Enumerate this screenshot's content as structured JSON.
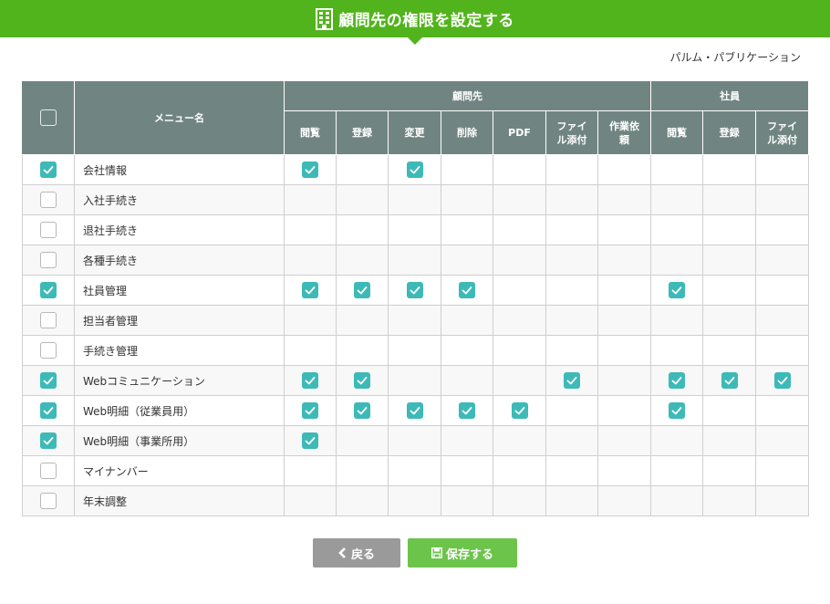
{
  "header": {
    "title": "顧問先の権限を設定する",
    "icon": "building-icon"
  },
  "company_name": "パルム・パブリケーション",
  "table": {
    "menu_col_label": "メニュー名",
    "group_client": "顧問先",
    "group_employee": "社員",
    "client_cols": [
      "閲覧",
      "登録",
      "変更",
      "削除",
      "PDF",
      "ファイル添付",
      "作業依頼"
    ],
    "client_cols_display": [
      "閲覧",
      "登録",
      "変更",
      "削除",
      "PDF",
      "ファイ\nル添付",
      "作業依\n頼"
    ],
    "employee_cols_display": [
      "閲覧",
      "登録",
      "ファイ\nル添付"
    ],
    "rows": [
      {
        "name": "会社情報",
        "checked": true,
        "client": [
          1,
          0,
          1,
          0,
          0,
          0,
          0
        ],
        "employee": [
          0,
          0,
          0
        ]
      },
      {
        "name": "入社手続き",
        "checked": false,
        "client": [
          0,
          0,
          0,
          0,
          0,
          0,
          0
        ],
        "employee": [
          0,
          0,
          0
        ]
      },
      {
        "name": "退社手続き",
        "checked": false,
        "client": [
          0,
          0,
          0,
          0,
          0,
          0,
          0
        ],
        "employee": [
          0,
          0,
          0
        ]
      },
      {
        "name": "各種手続き",
        "checked": false,
        "client": [
          0,
          0,
          0,
          0,
          0,
          0,
          0
        ],
        "employee": [
          0,
          0,
          0
        ]
      },
      {
        "name": "社員管理",
        "checked": true,
        "client": [
          1,
          1,
          1,
          1,
          0,
          0,
          0
        ],
        "employee": [
          1,
          0,
          0
        ]
      },
      {
        "name": "担当者管理",
        "checked": false,
        "client": [
          0,
          0,
          0,
          0,
          0,
          0,
          0
        ],
        "employee": [
          0,
          0,
          0
        ]
      },
      {
        "name": "手続き管理",
        "checked": false,
        "client": [
          0,
          0,
          0,
          0,
          0,
          0,
          0
        ],
        "employee": [
          0,
          0,
          0
        ]
      },
      {
        "name": "Webコミュニケーション",
        "checked": true,
        "client": [
          1,
          1,
          0,
          0,
          0,
          1,
          0
        ],
        "employee": [
          1,
          1,
          1
        ]
      },
      {
        "name": "Web明細（従業員用）",
        "checked": true,
        "client": [
          1,
          1,
          1,
          1,
          1,
          0,
          0
        ],
        "employee": [
          1,
          0,
          0
        ]
      },
      {
        "name": "Web明細（事業所用）",
        "checked": true,
        "client": [
          1,
          0,
          0,
          0,
          0,
          0,
          0
        ],
        "employee": [
          0,
          0,
          0
        ]
      },
      {
        "name": "マイナンバー",
        "checked": false,
        "client": [
          0,
          0,
          0,
          0,
          0,
          0,
          0
        ],
        "employee": [
          0,
          0,
          0
        ]
      },
      {
        "name": "年末調整",
        "checked": false,
        "client": [
          0,
          0,
          0,
          0,
          0,
          0,
          0
        ],
        "employee": [
          0,
          0,
          0
        ]
      }
    ]
  },
  "buttons": {
    "back_label": "戻る",
    "save_label": "保存する"
  },
  "colors": {
    "brand_green": "#52b41c",
    "header_gray": "#708581",
    "check_teal": "#3dbab7",
    "back_gray": "#9a9a9a",
    "save_green": "#6cc44a"
  }
}
